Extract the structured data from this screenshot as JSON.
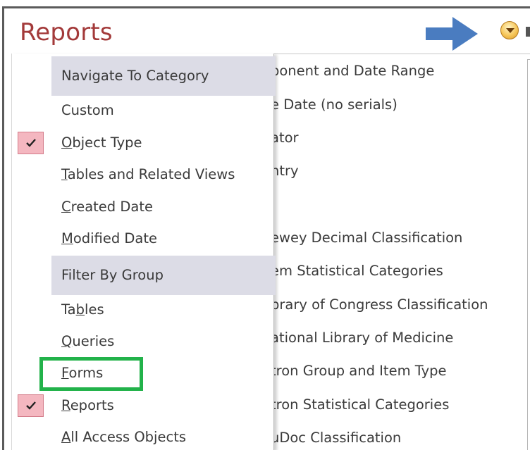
{
  "pane": {
    "title": "Reports",
    "list_items": [
      "ponent and Date Range",
      "e Date (no serials)",
      "ator",
      "ntry",
      "ewey Decimal Classification",
      "em Statistical Categories",
      "brary of Congress Classification",
      "ational Library of Medicine",
      "tron Group and Item Type",
      "tron Statistical Categories",
      "uDoc Classification"
    ]
  },
  "menu": {
    "navigate_header": "Navigate To Category",
    "navigate_items": [
      {
        "label": "Custom",
        "checked": false
      },
      {
        "label": "Object Type",
        "checked": true
      },
      {
        "label": "Tables and Related Views",
        "checked": false
      },
      {
        "label": "Created Date",
        "checked": false
      },
      {
        "label": "Modified Date",
        "checked": false
      }
    ],
    "filter_header": "Filter By Group",
    "filter_items": [
      {
        "label": "Tables",
        "checked": false
      },
      {
        "label": "Queries",
        "checked": false
      },
      {
        "label": "Forms",
        "checked": false
      },
      {
        "label": "Reports",
        "checked": true
      },
      {
        "label": "All Access Objects",
        "checked": false
      }
    ]
  },
  "icons": {
    "arrow": "right-arrow-icon",
    "dropdown": "chevron-down-icon",
    "check": "checkmark-icon"
  },
  "colors": {
    "title": "#a33a3a",
    "arrow": "#4a7cc0",
    "menu_header_bg": "#dcdce6",
    "check_bg": "#f4b7c0",
    "highlight": "#22b24a"
  }
}
